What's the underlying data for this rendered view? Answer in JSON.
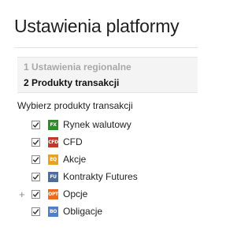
{
  "page": {
    "title": "Ustawienia platformy"
  },
  "steps": [
    {
      "label": "1 Ustawienia regionalne",
      "state": "inactive"
    },
    {
      "label": "2 Produkty transakcji",
      "state": "active"
    }
  ],
  "products": {
    "section_label": "Wybierz produkty transakcji",
    "items": [
      {
        "label": "Rynek walutowy",
        "badge": "FX",
        "badge_color": "#2e8b2e",
        "checked": true,
        "expand": ""
      },
      {
        "label": "CFD",
        "badge": "CFD",
        "badge_color": "#c0392b",
        "checked": true,
        "expand": ""
      },
      {
        "label": "Akcje",
        "badge": "EQ",
        "badge_color": "#e8a21f",
        "checked": true,
        "expand": ""
      },
      {
        "label": "Kontrakty Futures",
        "badge": "FU",
        "badge_color": "#4f6d9a",
        "checked": true,
        "expand": ""
      },
      {
        "label": "Opcje",
        "badge": "OPT",
        "badge_color": "#ee6a1e",
        "checked": true,
        "expand": "+"
      },
      {
        "label": "Obligacje",
        "badge": "BO",
        "badge_color": "#4f7fc4",
        "checked": true,
        "expand": ""
      }
    ]
  }
}
